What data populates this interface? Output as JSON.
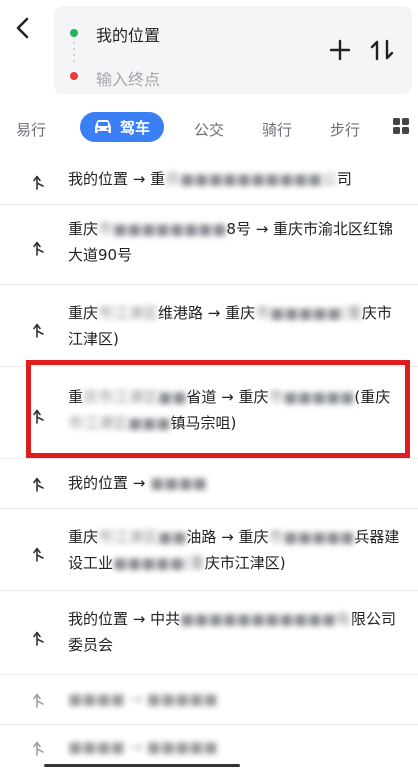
{
  "route": {
    "start_label": "我的位置",
    "end_placeholder": "输入终点"
  },
  "tabs": [
    {
      "label": "易行"
    },
    {
      "label": "驾车",
      "active": true
    },
    {
      "label": "公交"
    },
    {
      "label": "骑行"
    },
    {
      "label": "步行"
    }
  ],
  "history": [
    {
      "parts": [
        "我的位置 → 重",
        "庆■■■■■■■■■■公",
        "司"
      ]
    },
    {
      "parts": [
        "重庆",
        "市■■■■■■■■",
        "8号 → 重庆市渝北区红锦大道90号"
      ]
    },
    {
      "parts": [
        "重庆",
        "市江津区",
        "维港路 → 重庆",
        "市■■■■■(重",
        "庆市江津区)"
      ]
    },
    {
      "parts": [
        "重",
        "庆市江津区■■",
        "省道 → 重庆",
        "市■■■■■",
        "(重庆",
        "市江津区■■■",
        "镇马宗咀)"
      ]
    },
    {
      "parts": [
        "我的位置 → ",
        "■■■■"
      ]
    },
    {
      "parts": [
        "重庆",
        "市江津区■■",
        "油路 → 重庆",
        "市■■■■■",
        "兵器建设工业",
        "■■■■■(重",
        "庆市江津区)"
      ]
    },
    {
      "parts": [
        "我的位置 → 中共",
        "■■■■■■■■■■■有",
        "限公司委员会"
      ]
    },
    {
      "parts": [
        "■■■■ → ■■■■■"
      ]
    },
    {
      "parts": [
        "■■■■ → ■■■■■"
      ]
    }
  ],
  "colors": {
    "accent": "#3a7ff6",
    "start_dot": "#21b35a",
    "end_dot": "#e83a36",
    "highlight": "#e11c1c"
  },
  "icons": [
    "back-arrow-icon",
    "add-icon",
    "swap-icon",
    "car-icon",
    "grid-menu-icon",
    "turn-arrow-icon"
  ]
}
